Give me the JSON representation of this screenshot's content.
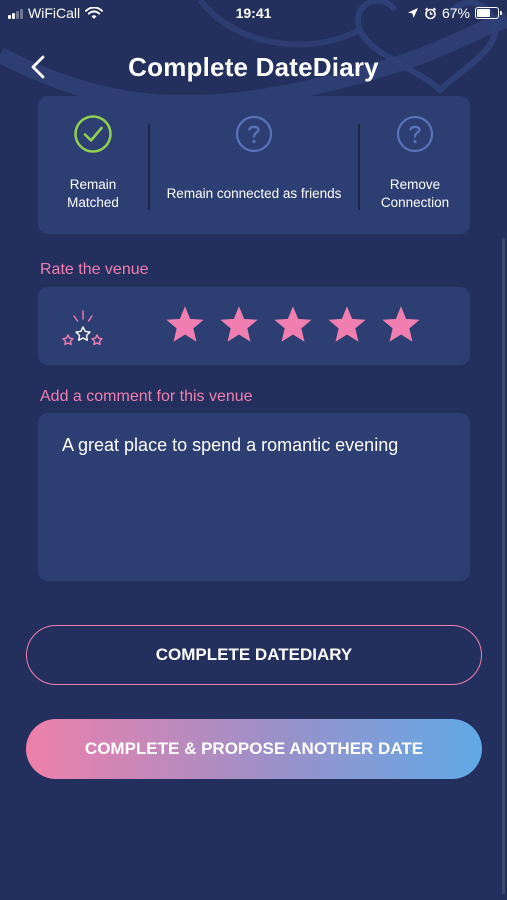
{
  "status_bar": {
    "carrier": "WiFiCall",
    "time": "19:41",
    "battery": "67%",
    "battery_level": 0.67
  },
  "header": {
    "title": "Complete DateDiary",
    "back_icon": "chevron-left-icon"
  },
  "options": [
    {
      "label": "Remain Matched",
      "icon": "check-circle-icon",
      "selected": true
    },
    {
      "label": "Remain connected as friends",
      "icon": "question-circle-icon",
      "selected": false
    },
    {
      "label": "Remove Connection",
      "icon": "question-circle-icon",
      "selected": false
    }
  ],
  "rating": {
    "label": "Rate the venue",
    "rating_icon": "sparkle-stars-icon",
    "value": 5,
    "max": 5
  },
  "comment": {
    "label": "Add a comment for this venue",
    "value": "A great place to spend a romantic evening"
  },
  "buttons": {
    "complete": "COMPLETE DATEDIARY",
    "complete_propose": "COMPLETE & PROPOSE ANOTHER DATE"
  },
  "colors": {
    "background": "#232f5c",
    "card": "#2d3e73",
    "accent_pink": "#f07eb0",
    "check_green": "#8fd14f",
    "question_blue": "#5a73b8",
    "gradient_end": "#60a9e6"
  }
}
